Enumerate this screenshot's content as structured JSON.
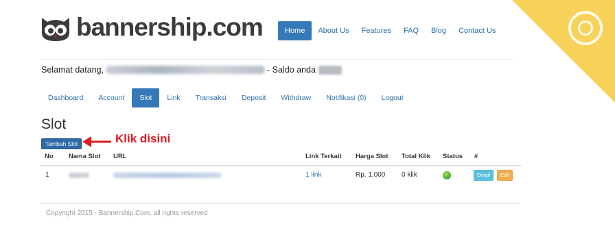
{
  "brand": {
    "name": "bannership.com"
  },
  "nav": {
    "items": [
      "Home",
      "About Us",
      "Features",
      "FAQ",
      "Blog",
      "Contact Us"
    ],
    "active": "Home"
  },
  "welcome": {
    "prefix": "Selamat datang,",
    "middle": "- Saldo anda"
  },
  "tabs": {
    "items": [
      "Dashboard",
      "Account",
      "Slot",
      "Link",
      "Transaksi",
      "Deposit",
      "Withdraw",
      "Notifikasi (0)",
      "Logout"
    ],
    "active": "Slot"
  },
  "page": {
    "title": "Slot",
    "add_button": "Tambah Slot",
    "annotation": "Klik disini"
  },
  "table": {
    "headers": [
      "No",
      "Nama Slot",
      "URL",
      "Link Terkait",
      "Harga Slot",
      "Total Klik",
      "Status",
      "#"
    ],
    "rows": [
      {
        "no": "1",
        "link_terkait": "1 link",
        "harga": "Rp. 1,000",
        "klik": "0 klik",
        "detail": "Detail",
        "edit": "Edit"
      }
    ]
  },
  "footer": {
    "copyright": "Copyright 2015 - Bannership.Com, all rights reserved"
  },
  "colors": {
    "primary": "#3579b8",
    "annotation": "#e3191f",
    "corner": "#f7d25a",
    "status_ok": "#4cae2a"
  }
}
